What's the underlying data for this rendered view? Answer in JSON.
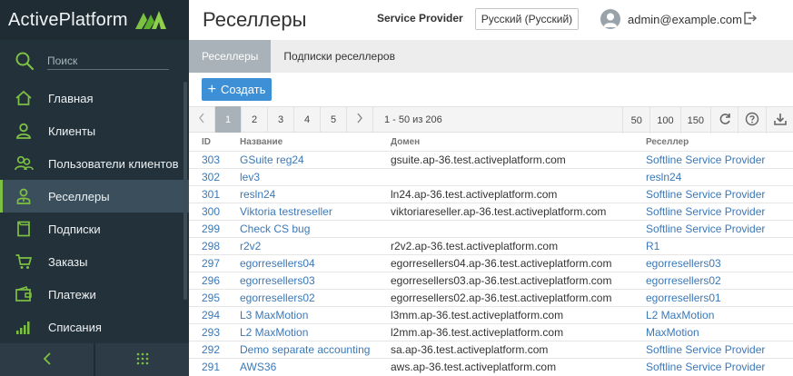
{
  "sidebar": {
    "logo_text": "ActivePlatform",
    "search_placeholder": "Поиск",
    "items": [
      {
        "label": "Главная",
        "icon": "home-icon"
      },
      {
        "label": "Клиенты",
        "icon": "user-icon"
      },
      {
        "label": "Пользователи клиентов",
        "icon": "users-icon"
      },
      {
        "label": "Реселлеры",
        "icon": "reseller-icon",
        "active": true
      },
      {
        "label": "Подписки",
        "icon": "subscription-icon"
      },
      {
        "label": "Заказы",
        "icon": "cart-icon"
      },
      {
        "label": "Платежи",
        "icon": "wallet-icon"
      },
      {
        "label": "Списания",
        "icon": "bars-icon"
      }
    ],
    "accent": "#7dc142"
  },
  "header": {
    "title": "Реселлеры",
    "provider": "Service Provider",
    "language": "Русский (Русский)",
    "user_email": "admin@example.com"
  },
  "tabs": [
    {
      "label": "Реселлеры",
      "active": true
    },
    {
      "label": "Подписки реселлеров",
      "active": false
    }
  ],
  "create_label": "Создать",
  "pager": {
    "pages": [
      "1",
      "2",
      "3",
      "4",
      "5"
    ],
    "current": "1",
    "range": "1 - 50 из 206",
    "sizes": [
      "50",
      "100",
      "150"
    ]
  },
  "table": {
    "columns": {
      "id": "ID",
      "name": "Название",
      "domain": "Домен",
      "reseller": "Реселлер"
    },
    "rows": [
      {
        "id": "303",
        "name": "GSuite reg24",
        "domain": "gsuite.ap-36.test.activeplatform.com",
        "reseller": "Softline Service Provider"
      },
      {
        "id": "302",
        "name": "lev3",
        "domain": "",
        "reseller": "resln24"
      },
      {
        "id": "301",
        "name": "resln24",
        "domain": "ln24.ap-36.test.activeplatform.com",
        "reseller": "Softline Service Provider"
      },
      {
        "id": "300",
        "name": "Viktoria testreseller",
        "domain": "viktoriareseller.ap-36.test.activeplatform.com",
        "reseller": "Softline Service Provider"
      },
      {
        "id": "299",
        "name": "Check CS bug",
        "domain": "",
        "reseller": "Softline Service Provider"
      },
      {
        "id": "298",
        "name": "r2v2",
        "domain": "r2v2.ap-36.test.activeplatform.com",
        "reseller": "R1"
      },
      {
        "id": "297",
        "name": "egorresellers04",
        "domain": "egorresellers04.ap-36.test.activeplatform.com",
        "reseller": "egorresellers03"
      },
      {
        "id": "296",
        "name": "egorresellers03",
        "domain": "egorresellers03.ap-36.test.activeplatform.com",
        "reseller": "egorresellers02"
      },
      {
        "id": "295",
        "name": "egorresellers02",
        "domain": "egorresellers02.ap-36.test.activeplatform.com",
        "reseller": "egorresellers01"
      },
      {
        "id": "294",
        "name": "L3 MaxMotion",
        "domain": "l3mm.ap-36.test.activeplatform.com",
        "reseller": "L2 MaxMotion"
      },
      {
        "id": "293",
        "name": "L2 MaxMotion",
        "domain": "l2mm.ap-36.test.activeplatform.com",
        "reseller": "MaxMotion"
      },
      {
        "id": "292",
        "name": "Demo separate accounting",
        "domain": "sa.ap-36.test.activeplatform.com",
        "reseller": "Softline Service Provider"
      },
      {
        "id": "291",
        "name": "AWS36",
        "domain": "aws.ap-36.test.activeplatform.com",
        "reseller": "Softline Service Provider"
      }
    ]
  }
}
